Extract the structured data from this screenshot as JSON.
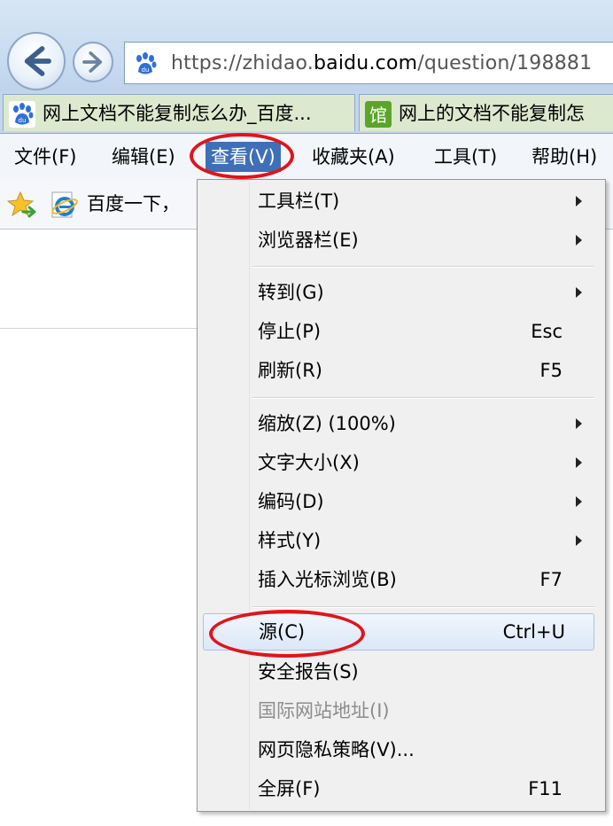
{
  "address_bar": {
    "scheme": "https://zhidao.",
    "host": "baidu.com",
    "path": "/question/198881"
  },
  "tabs": [
    {
      "label": "网上文档不能复制怎么办_百度...",
      "icon": "baidu-paw-icon",
      "color": "#2f6fd8"
    },
    {
      "label": "网上的文档不能复制怎",
      "icon": "library-guan-icon",
      "icon_char": "馆",
      "color": "#5aa52a"
    }
  ],
  "menubar": {
    "items": [
      "文件(F)",
      "编辑(E)",
      "查看(V)",
      "收藏夹(A)",
      "工具(T)",
      "帮助(H)"
    ],
    "active": "查看(V)"
  },
  "favorites_bar": {
    "item_label": "百度一下，"
  },
  "view_menu": {
    "items": [
      {
        "label": "工具栏(T)",
        "shortcut": "",
        "submenu": true
      },
      {
        "label": "浏览器栏(E)",
        "shortcut": "",
        "submenu": true
      },
      {
        "label": "转到(G)",
        "shortcut": "",
        "submenu": true
      },
      {
        "label": "停止(P)",
        "shortcut": "Esc",
        "submenu": false
      },
      {
        "label": "刷新(R)",
        "shortcut": "F5",
        "submenu": false
      },
      {
        "label": "缩放(Z) (100%)",
        "shortcut": "",
        "submenu": true
      },
      {
        "label": "文字大小(X)",
        "shortcut": "",
        "submenu": true
      },
      {
        "label": "编码(D)",
        "shortcut": "",
        "submenu": true
      },
      {
        "label": "样式(Y)",
        "shortcut": "",
        "submenu": true
      },
      {
        "label": "插入光标浏览(B)",
        "shortcut": "F7",
        "submenu": false
      },
      {
        "label": "源(C)",
        "shortcut": "Ctrl+U",
        "submenu": false,
        "highlighted": true
      },
      {
        "label": "安全报告(S)",
        "shortcut": "",
        "submenu": false
      },
      {
        "label": "国际网站地址(I)",
        "shortcut": "",
        "submenu": false,
        "disabled": true
      },
      {
        "label": "网页隐私策略(V)...",
        "shortcut": "",
        "submenu": false
      },
      {
        "label": "全屏(F)",
        "shortcut": "F11",
        "submenu": false
      }
    ]
  },
  "annotation_color": "#e0141a"
}
